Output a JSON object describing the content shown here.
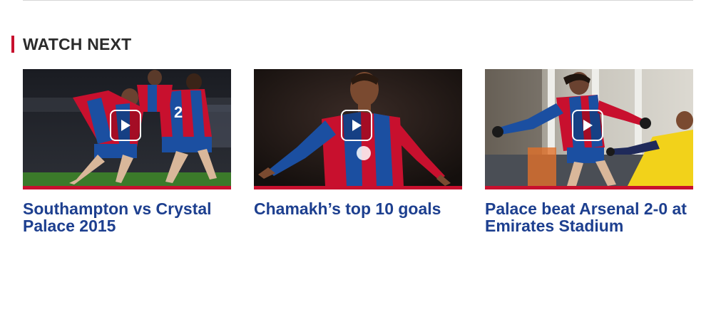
{
  "section": {
    "title": "WATCH NEXT",
    "accent_color": "#c8102e"
  },
  "colors": {
    "title_link": "#1d3f8f",
    "stripe": "#c8102e"
  },
  "videos": [
    {
      "title": "Southampton vs Crystal Palace 2015",
      "thumbnail": "players-celebrating-on-pitch",
      "play_icon": "play-icon"
    },
    {
      "title": "Chamakh’s top 10 goals",
      "thumbnail": "player-celebrating-arms-out",
      "play_icon": "play-icon"
    },
    {
      "title": "Palace beat Arsenal 2-0 at Emirates Stadium",
      "thumbnail": "player-shooting-ball",
      "play_icon": "play-icon"
    }
  ]
}
